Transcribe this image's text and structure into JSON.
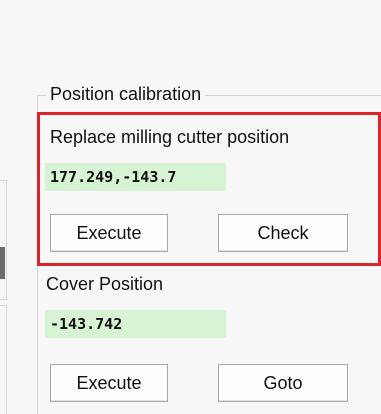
{
  "group": {
    "title": "Position calibration"
  },
  "replace_milling_cutter": {
    "label": "Replace milling cutter position",
    "value": "177.249,-143.7",
    "execute_label": "Execute",
    "check_label": "Check"
  },
  "cover_position": {
    "label": "Cover Position",
    "value": "-143.742",
    "execute_label": "Execute",
    "goto_label": "Goto"
  },
  "colors": {
    "highlight": "#d9252b",
    "value_background": "#d6f3d3"
  }
}
